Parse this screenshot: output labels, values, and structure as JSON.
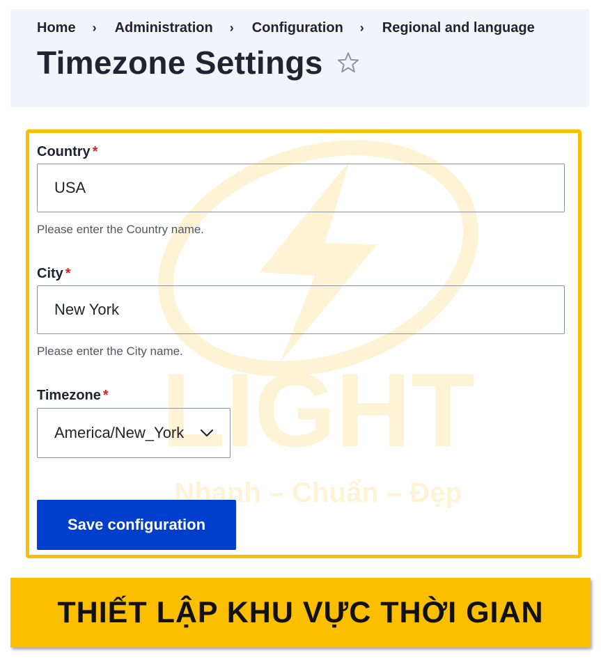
{
  "breadcrumb": {
    "items": [
      "Home",
      "Administration",
      "Configuration",
      "Regional and language"
    ],
    "separator": "›"
  },
  "page": {
    "title": "Timezone Settings",
    "favorite_icon": "star-outline-icon"
  },
  "form": {
    "country": {
      "label": "Country",
      "required_mark": "*",
      "value": "USA",
      "help": "Please enter the Country name."
    },
    "city": {
      "label": "City",
      "required_mark": "*",
      "value": "New York",
      "help": "Please enter the City name."
    },
    "timezone": {
      "label": "Timezone",
      "required_mark": "*",
      "selected": "America/New_York",
      "icon": "chevron-down-icon"
    },
    "save_label": "Save configuration"
  },
  "watermark": {
    "brand": "LIGHT",
    "tagline": "Nhanh – Chuẩn – Đẹp",
    "icon": "lightning-bolt-icon"
  },
  "banner": {
    "text": "THIẾT LẬP KHU VỰC THỜI GIAN"
  },
  "colors": {
    "accent_yellow": "#fbbf00",
    "primary_button": "#003ecc",
    "required_red": "#d72222",
    "header_bg": "#f3f4f9"
  }
}
